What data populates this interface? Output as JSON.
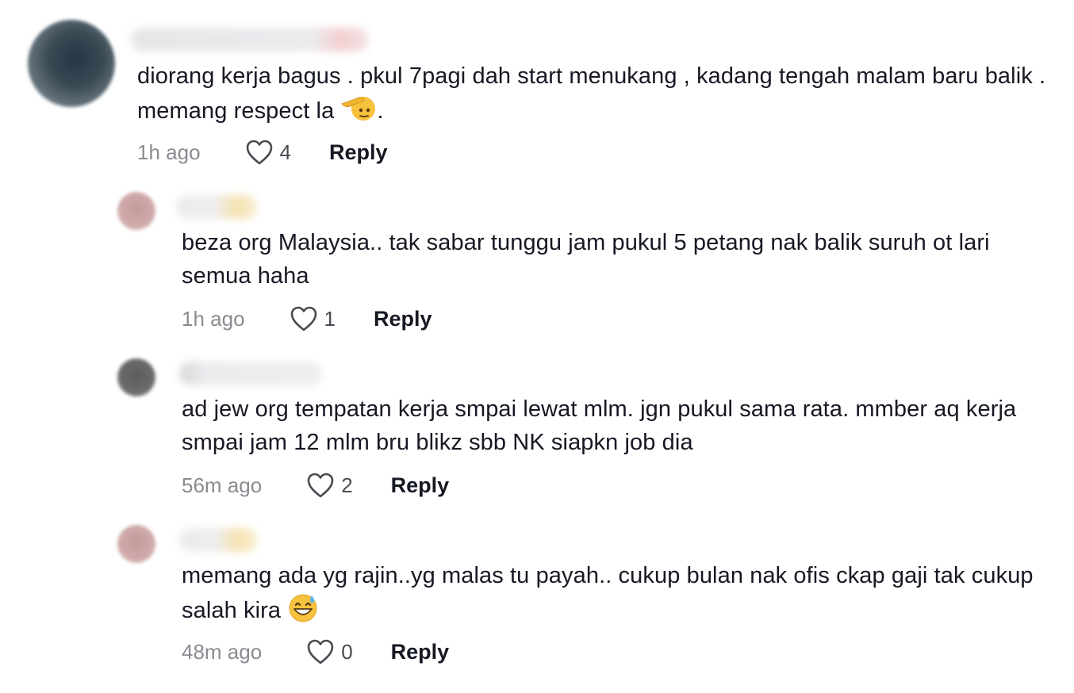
{
  "comments": [
    {
      "text_prefix": "diorang kerja bagus . pkul 7pagi dah start menukang , kadang tengah malam baru balik . memang respect la ",
      "text_suffix": ".",
      "emoji_icon": "saluting-face-icon",
      "time": "1h ago",
      "likes": "4",
      "reply_label": "Reply"
    },
    {
      "text_prefix": "beza org Malaysia.. tak sabar tunggu jam pukul 5 petang nak balik suruh ot lari semua haha",
      "text_suffix": "",
      "time": "1h ago",
      "likes": "1",
      "reply_label": "Reply"
    },
    {
      "text_prefix": "ad jew org tempatan kerja smpai lewat mlm. jgn pukul sama rata. mmber aq kerja smpai jam 12 mlm bru blikz sbb NK siapkn job dia",
      "text_suffix": "",
      "time": "56m ago",
      "likes": "2",
      "reply_label": "Reply"
    },
    {
      "text_prefix": "memang ada yg rajin..yg malas tu payah.. cukup bulan nak ofis ckap gaji tak cukup salah kira ",
      "text_suffix": "",
      "emoji_icon": "grinning-sweat-face-icon",
      "time": "48m ago",
      "likes": "0",
      "reply_label": "Reply"
    }
  ],
  "colors": {
    "text": "#161823",
    "muted": "#8a8b91",
    "background": "#ffffff"
  }
}
